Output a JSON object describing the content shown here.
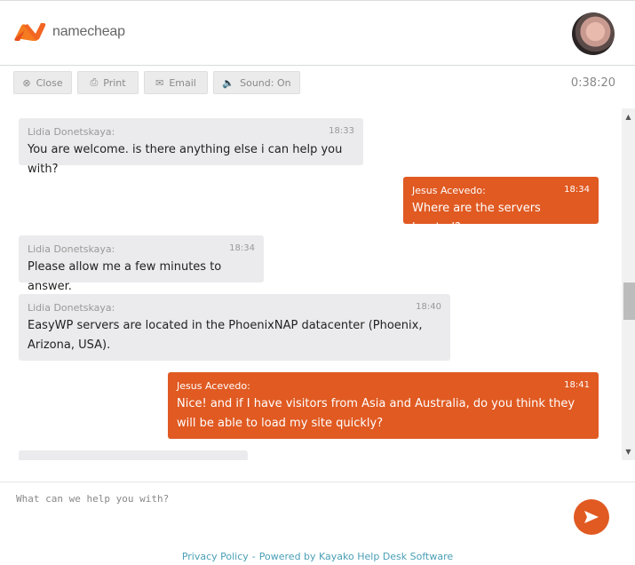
{
  "header": {
    "brand": "namecheap",
    "brand_color": "#f26522",
    "avatar_alt": "agent-avatar"
  },
  "toolbar": {
    "close_label": "Close",
    "print_label": "Print",
    "email_label": "Email",
    "sound_label": "Sound: On",
    "timer": "0:38:20"
  },
  "messages": [
    {
      "author": "Lidia Donetskaya:",
      "time": "18:33",
      "text": "You are welcome. is there anything else i can help you with?",
      "side": "agent"
    },
    {
      "author": "Jesus Acevedo:",
      "time": "18:34",
      "text": "Where are the servers located?",
      "side": "user"
    },
    {
      "author": "Lidia Donetskaya:",
      "time": "18:34",
      "text": "Please allow me a few minutes to answer.",
      "side": "agent"
    },
    {
      "author": "Lidia Donetskaya:",
      "time": "18:40",
      "text": "EasyWP servers are located in the PhoenixNAP datacenter (Phoenix, Arizona, USA).",
      "side": "agent"
    },
    {
      "author": "Jesus Acevedo:",
      "time": "18:41",
      "text": "Nice! and if I have visitors from Asia and Australia, do you think they will be able to load my site quickly?",
      "side": "user"
    }
  ],
  "composer": {
    "placeholder": "What can we help you with?",
    "value": ""
  },
  "footer": {
    "privacy_label": "Privacy Policy",
    "separator": "-",
    "powered_label": "Powered by Kayako Help Desk Software"
  },
  "colors": {
    "accent": "#e05a22",
    "agent_bubble": "#ebebed",
    "link": "#4a9fb5"
  }
}
